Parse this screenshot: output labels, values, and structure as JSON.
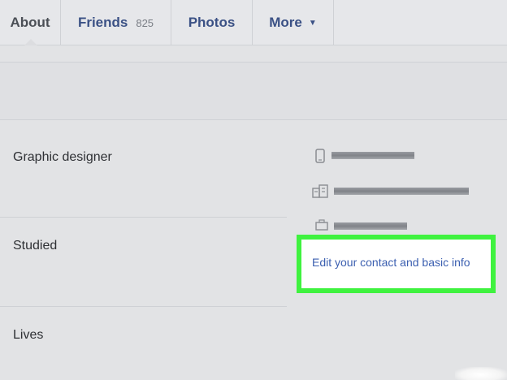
{
  "tabs": {
    "about": "About",
    "friends": "Friends",
    "friends_count": "825",
    "photos": "Photos",
    "more": "More",
    "more_caret": "▼"
  },
  "about": {
    "work": "Graphic designer",
    "education": "Studied",
    "residence": "Lives"
  },
  "contact": {
    "icons": [
      "phone-icon",
      "building-icon",
      "briefcase-icon"
    ],
    "edit_link": "Edit your contact and basic info"
  },
  "colors": {
    "highlight": "#3ff23f",
    "link": "#3b5fb0",
    "tab_text": "#3b5185"
  }
}
